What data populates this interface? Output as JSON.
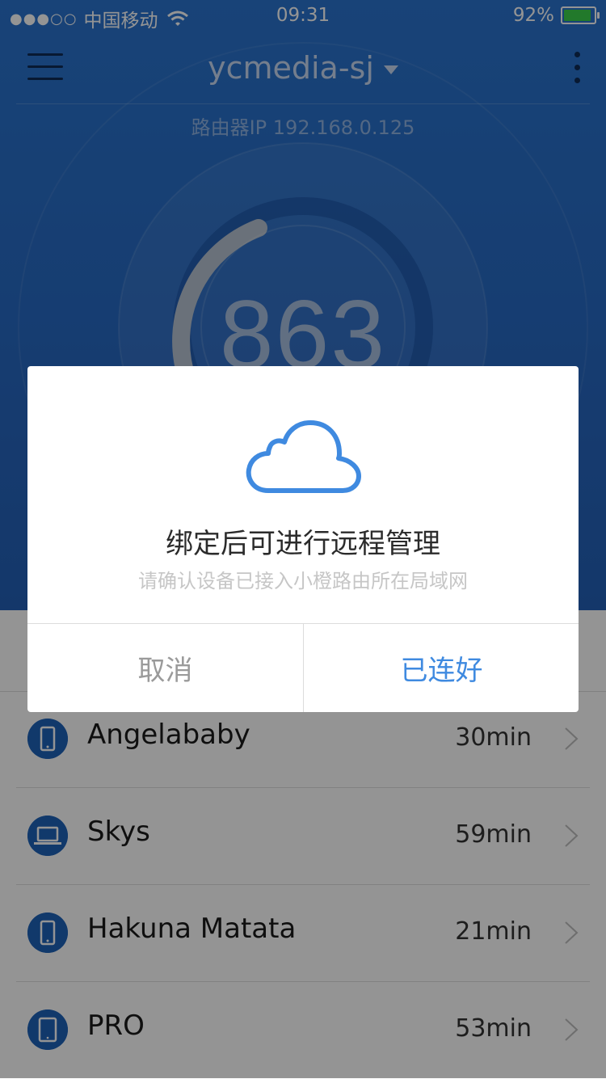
{
  "status_bar": {
    "signal_dots": "●●●○○",
    "carrier": "中国移动",
    "time": "09:31",
    "battery_percent": "92%",
    "battery_level": 0.92,
    "icons": [
      "wifi-icon",
      "battery-icon"
    ]
  },
  "header": {
    "network_name": "ycmedia-sj",
    "router_ip": "路由器IP 192.168.0.125",
    "score": "863",
    "icons": [
      "menu-icon",
      "dropdown-caret-icon",
      "more-icon"
    ]
  },
  "devices": [
    {
      "name": "Angelababy",
      "time": "30min",
      "icon": "phone-icon"
    },
    {
      "name": "Skys",
      "time": "59min",
      "icon": "laptop-icon"
    },
    {
      "name": "Hakuna Matata",
      "time": "21min",
      "icon": "phone-icon"
    },
    {
      "name": "PRO",
      "time": "53min",
      "icon": "tablet-icon"
    }
  ],
  "dialog": {
    "icon": "cloud-icon",
    "title": "绑定后可进行远程管理",
    "subtitle": "请确认设备已接入小橙路由所在局域网",
    "cancel_label": "取消",
    "confirm_label": "已连好"
  },
  "colors": {
    "header_blue": "#2769c3",
    "accent_blue": "#3f8ae0",
    "device_icon_bg": "#1e62b9",
    "battery_green": "#3bd14a"
  }
}
